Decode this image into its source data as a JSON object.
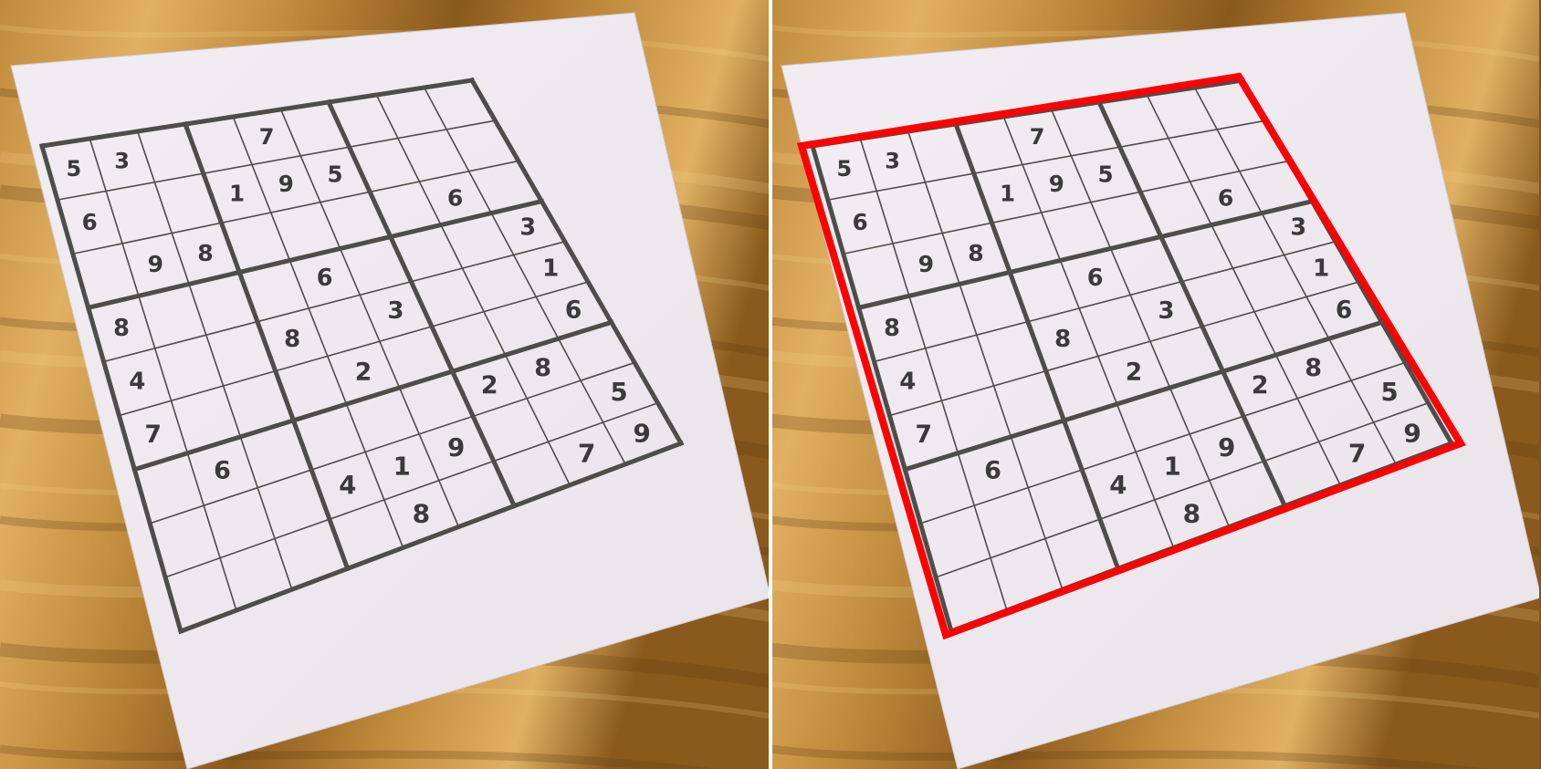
{
  "panels": [
    {
      "name": "original-photo",
      "show_detection": false
    },
    {
      "name": "detected-grid-photo",
      "show_detection": true
    }
  ],
  "detection": {
    "color": "#ff0000"
  },
  "colors": {
    "wood_dark": "#8a5a1c",
    "wood_mid": "#c08a3c",
    "wood_light": "#e0b063",
    "paper": "#e9e4ea",
    "grid_line": "#4d4d4a"
  },
  "puzzle": {
    "rows": [
      [
        "5",
        "3",
        "",
        "",
        "7",
        "",
        "",
        "",
        ""
      ],
      [
        "6",
        "",
        "",
        "1",
        "9",
        "5",
        "",
        "",
        ""
      ],
      [
        "",
        "9",
        "8",
        "",
        "",
        "",
        "",
        "6",
        ""
      ],
      [
        "8",
        "",
        "",
        "",
        "6",
        "",
        "",
        "",
        "3"
      ],
      [
        "4",
        "",
        "",
        "8",
        "",
        "3",
        "",
        "",
        "1"
      ],
      [
        "7",
        "",
        "",
        "",
        "2",
        "",
        "",
        "",
        "6"
      ],
      [
        "",
        "6",
        "",
        "",
        "",
        "",
        "2",
        "8",
        ""
      ],
      [
        "",
        "",
        "",
        "4",
        "1",
        "9",
        "",
        "",
        "5"
      ],
      [
        "",
        "",
        "",
        "",
        "8",
        "",
        "",
        "7",
        "9"
      ]
    ]
  }
}
